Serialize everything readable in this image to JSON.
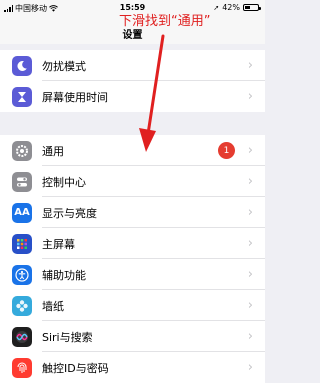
{
  "status_bar": {
    "carrier": "中国移动",
    "time": "15:59",
    "battery": "42%"
  },
  "nav": {
    "title": "设置"
  },
  "annotation": {
    "text": "下滑找到“通用”",
    "color": "#e02020"
  },
  "group1": [
    {
      "icon": "moon-icon",
      "label": "勿扰模式",
      "color": "#5b5bd6"
    },
    {
      "icon": "hourglass-icon",
      "label": "屏幕使用时间",
      "color": "#5b5bd6"
    }
  ],
  "group2": [
    {
      "icon": "gear-icon",
      "label": "通用",
      "color": "#8e8e93",
      "badge": "1"
    },
    {
      "icon": "toggles-icon",
      "label": "控制中心",
      "color": "#8e8e93"
    },
    {
      "icon": "text-size-icon",
      "label": "显示与亮度",
      "color": "#1a73e8",
      "glyph": "AA"
    },
    {
      "icon": "grid-icon",
      "label": "主屏幕",
      "color": "#2850c8"
    },
    {
      "icon": "accessibility-icon",
      "label": "辅助功能",
      "color": "#1a73e8"
    },
    {
      "icon": "flower-icon",
      "label": "墙纸",
      "color": "#35aadc"
    },
    {
      "icon": "siri-icon",
      "label": "Siri与搜索",
      "color": "#1f1f1f"
    },
    {
      "icon": "fingerprint-icon",
      "label": "触控ID与密码",
      "color": "#ff3b30"
    }
  ]
}
